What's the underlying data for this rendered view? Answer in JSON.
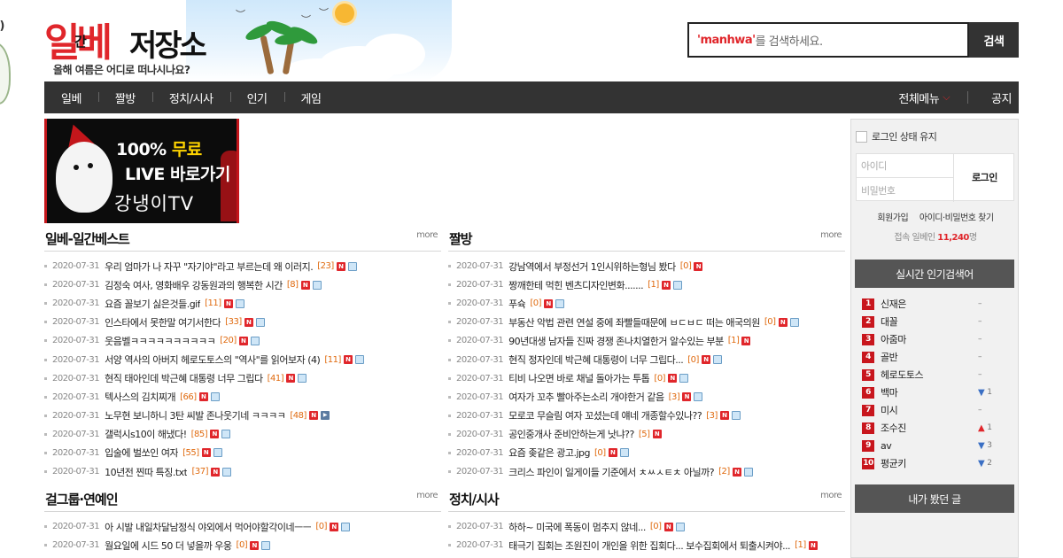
{
  "edge_widget": {
    "text": "금)"
  },
  "header": {
    "logo_main": "일베",
    "logo_gan": "간",
    "logo_sub": "저장소",
    "tagline": "올해 여름은 어디로 떠나시나요?",
    "search": {
      "keyword": "'manhwa'",
      "suffix": " 를 검색하세요.",
      "button": "검색"
    }
  },
  "nav": {
    "items": [
      "일베",
      "짤방",
      "정치/시사",
      "인기",
      "게임"
    ],
    "all_menu": "전체메뉴",
    "notice": "공지"
  },
  "banner": {
    "line1a": "100% ",
    "line1b": "무료",
    "line2": "LIVE 바로가기",
    "line3": "강냉이TV"
  },
  "sections": {
    "best": {
      "title": "일베-일간베스트",
      "more": "more",
      "rows": [
        {
          "date": "2020-07-31",
          "title": "우리 엄마가 나 자꾸 \"자기야\"라고 부르는데 왜 이러지.",
          "count": "[23]",
          "icons": [
            "n",
            "img"
          ]
        },
        {
          "date": "2020-07-31",
          "title": "김정숙 여사, 영화배우 강동원과의 행복한 시간",
          "count": "[8]",
          "icons": [
            "n",
            "img"
          ]
        },
        {
          "date": "2020-07-31",
          "title": "요즘 꼴보기 싫은것들.gif",
          "count": "[11]",
          "icons": [
            "n",
            "img"
          ]
        },
        {
          "date": "2020-07-31",
          "title": "인스타에서 못한말 여기서한다",
          "count": "[33]",
          "icons": [
            "n",
            "img"
          ]
        },
        {
          "date": "2020-07-31",
          "title": "웃음벨ㅋㅋㅋㅋㅋㅋㅋㅋㅋㅋ",
          "count": "[20]",
          "icons": [
            "n",
            "img"
          ]
        },
        {
          "date": "2020-07-31",
          "title": "서양 역사의 아버지 헤로도토스의 \"역사\"를 읽어보자 (4)",
          "count": "[11]",
          "icons": [
            "n",
            "img"
          ]
        },
        {
          "date": "2020-07-31",
          "title": "현직 태아인데 박근혜 대통령 너무 그립다",
          "count": "[41]",
          "icons": [
            "n",
            "img"
          ]
        },
        {
          "date": "2020-07-31",
          "title": "텍사스의 김치찌개",
          "count": "[66]",
          "icons": [
            "n",
            "img"
          ]
        },
        {
          "date": "2020-07-31",
          "title": "노무현 보니하니 3탄 씨발 존나웃기네 ㅋㅋㅋㅋ",
          "count": "[48]",
          "icons": [
            "n",
            "vid"
          ]
        },
        {
          "date": "2020-07-31",
          "title": "갤럭시s10이 해냈다!",
          "count": "[85]",
          "icons": [
            "n",
            "img"
          ]
        },
        {
          "date": "2020-07-31",
          "title": "입술에 벌쏘인 여자",
          "count": "[55]",
          "icons": [
            "n",
            "img"
          ]
        },
        {
          "date": "2020-07-31",
          "title": "10년전 찐따 특징.txt",
          "count": "[37]",
          "icons": [
            "n",
            "img"
          ]
        }
      ]
    },
    "jjal": {
      "title": "짤방",
      "more": "more",
      "rows": [
        {
          "date": "2020-07-31",
          "title": "강남역에서 부정선거 1인시위하는형님 봤다",
          "count": "[0]",
          "icons": [
            "n"
          ]
        },
        {
          "date": "2020-07-31",
          "title": "짱깨한테 먹힌 벤츠디자인변화.......",
          "count": "[1]",
          "icons": [
            "n",
            "img"
          ]
        },
        {
          "date": "2020-07-31",
          "title": "푸슉",
          "count": "[0]",
          "icons": [
            "n",
            "img"
          ]
        },
        {
          "date": "2020-07-31",
          "title": "부동산 악법 관련 연설 중에 좌빨들때문에 ㅂㄷㅂㄷ 떠는 애국의원",
          "count": "[0]",
          "icons": [
            "n",
            "img"
          ]
        },
        {
          "date": "2020-07-31",
          "title": "90년대생 남자들 진짜 경쟁 존나치열한거 알수있는 부분",
          "count": "[1]",
          "icons": [
            "n"
          ]
        },
        {
          "date": "2020-07-31",
          "title": "현직 정자인데 박근혜 대통령이 너무 그립다...",
          "count": "[0]",
          "icons": [
            "n",
            "img"
          ]
        },
        {
          "date": "2020-07-31",
          "title": "티비 나오면 바로 채널 돌아가는 투톱",
          "count": "[0]",
          "icons": [
            "n",
            "img"
          ]
        },
        {
          "date": "2020-07-31",
          "title": "여자가 꼬추 빨아주는소리 개야한거 같음",
          "count": "[3]",
          "icons": [
            "n",
            "img"
          ]
        },
        {
          "date": "2020-07-31",
          "title": "모로코 무슬림 여자 꼬셨는데 얘네 개종할수있나??",
          "count": "[3]",
          "icons": [
            "n",
            "img"
          ]
        },
        {
          "date": "2020-07-31",
          "title": "공인중개사 준비안하는게 낫냐??",
          "count": "[5]",
          "icons": [
            "n"
          ]
        },
        {
          "date": "2020-07-31",
          "title": "요즘 좆같은 광고.jpg",
          "count": "[0]",
          "icons": [
            "n",
            "img"
          ]
        },
        {
          "date": "2020-07-31",
          "title": "크리스 파인이 일게이들 기준에서 ㅊㅆㅅㅌㅊ 아닐까?",
          "count": "[2]",
          "icons": [
            "n",
            "img"
          ]
        }
      ]
    },
    "girl": {
      "title": "걸그룹·연예인",
      "more": "more",
      "rows": [
        {
          "date": "2020-07-31",
          "title": "아 시발 내일차달남정식 야외에서 먹어야할각이네ㅡㅡ",
          "count": "[0]",
          "icons": [
            "n",
            "img"
          ]
        },
        {
          "date": "2020-07-31",
          "title": "월요일에 시드 50 더 넣을까 우웅",
          "count": "[0]",
          "icons": [
            "n",
            "img"
          ]
        }
      ]
    },
    "politics": {
      "title": "정치/시사",
      "more": "more",
      "rows": [
        {
          "date": "2020-07-31",
          "title": "하하~ 미국에 폭동이 멈추지 않네...",
          "count": "[0]",
          "icons": [
            "n",
            "img"
          ]
        },
        {
          "date": "2020-07-31",
          "title": "태극기 집회는 조원진이 개인을 위한 집회다... 보수집회에서 퇴출시켜야...",
          "count": "[1]",
          "icons": [
            "n"
          ]
        }
      ]
    }
  },
  "sidebar": {
    "keep_login": "로그인 상태 유지",
    "id_placeholder": "아이디",
    "pw_placeholder": "비밀번호",
    "login_button": "로그인",
    "signup": "회원가입",
    "find": "아이디·비밀번호 찾기",
    "online_prefix": "접속 일베인 ",
    "online_count": "11,240",
    "online_suffix": "명",
    "ranking_title": "실시간 인기검색어",
    "ranking": [
      {
        "rank": "1",
        "word": "신재은",
        "dir": "none",
        "change": "–"
      },
      {
        "rank": "2",
        "word": "대꼴",
        "dir": "none",
        "change": "–"
      },
      {
        "rank": "3",
        "word": "아줌마",
        "dir": "none",
        "change": "–"
      },
      {
        "rank": "4",
        "word": "골반",
        "dir": "none",
        "change": "–"
      },
      {
        "rank": "5",
        "word": "헤로도토스",
        "dir": "none",
        "change": "–"
      },
      {
        "rank": "6",
        "word": "백마",
        "dir": "down",
        "change": "1"
      },
      {
        "rank": "7",
        "word": "미시",
        "dir": "none",
        "change": "–"
      },
      {
        "rank": "8",
        "word": "조수진",
        "dir": "up",
        "change": "1"
      },
      {
        "rank": "9",
        "word": "av",
        "dir": "down",
        "change": "3"
      },
      {
        "rank": "10",
        "word": "평균키",
        "dir": "down",
        "change": "2"
      }
    ],
    "recent_title": "내가 봤던 글"
  },
  "colors": {
    "accent": "#e0262b",
    "nav_bg": "#333333",
    "count": "#e06b10"
  }
}
